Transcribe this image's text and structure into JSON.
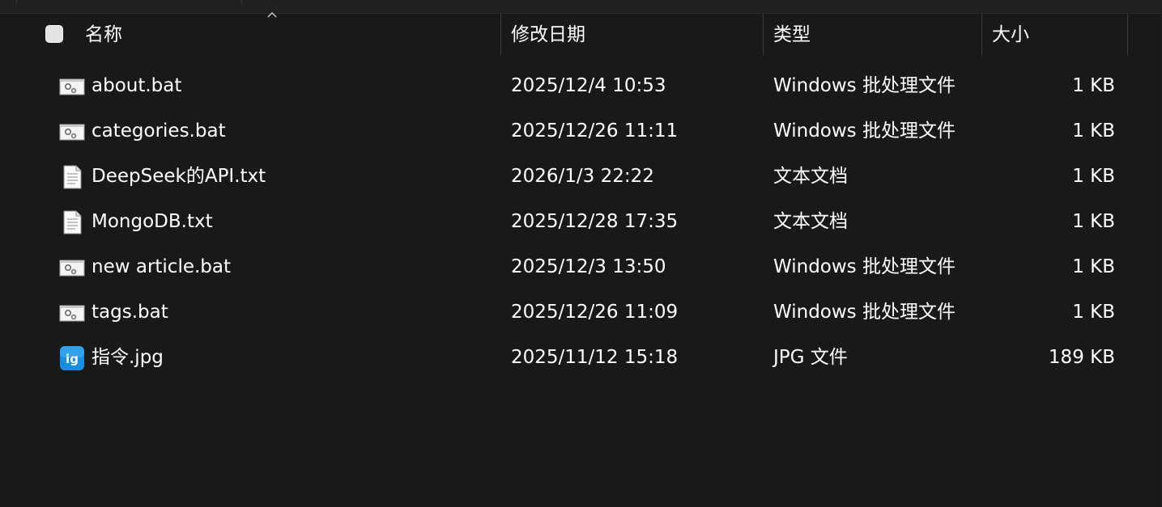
{
  "columns": {
    "name": "名称",
    "date_modified": "修改日期",
    "type": "类型",
    "size": "大小"
  },
  "sort": {
    "column": "name",
    "direction": "ascending",
    "indicator_icon": "chevron-up-icon"
  },
  "files": [
    {
      "name": "about.bat",
      "date": "2025/12/4 10:53",
      "type": "Windows 批处理文件",
      "size": "1 KB",
      "icon": "batch-file-icon"
    },
    {
      "name": "categories.bat",
      "date": "2025/12/26 11:11",
      "type": "Windows 批处理文件",
      "size": "1 KB",
      "icon": "batch-file-icon"
    },
    {
      "name": "DeepSeek的API.txt",
      "date": "2026/1/3 22:22",
      "type": "文本文档",
      "size": "1 KB",
      "icon": "text-file-icon"
    },
    {
      "name": "MongoDB.txt",
      "date": "2025/12/28 17:35",
      "type": "文本文档",
      "size": "1 KB",
      "icon": "text-file-icon"
    },
    {
      "name": "new article.bat",
      "date": "2025/12/3 13:50",
      "type": "Windows 批处理文件",
      "size": "1 KB",
      "icon": "batch-file-icon"
    },
    {
      "name": "tags.bat",
      "date": "2025/12/26 11:09",
      "type": "Windows 批处理文件",
      "size": "1 KB",
      "icon": "batch-file-icon"
    },
    {
      "name": "指令.jpg",
      "date": "2025/11/12 15:18",
      "type": "JPG 文件",
      "size": "189 KB",
      "icon": "jpg-image-icon"
    }
  ],
  "colors": {
    "background": "#191919",
    "text": "#ffffff",
    "separator": "#3a3a3a",
    "jpg_icon": "#1a8fe0"
  }
}
